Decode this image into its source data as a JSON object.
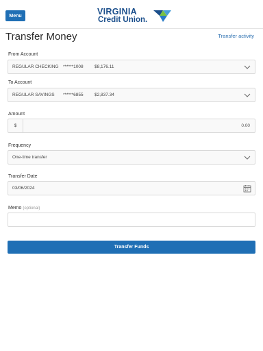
{
  "header": {
    "menu_label": "Menu",
    "logo_line1": "VIRGINIA",
    "logo_line2": "Credit Union."
  },
  "page": {
    "title": "Transfer Money",
    "activity_link": "Transfer activity"
  },
  "from_account": {
    "label": "From Account",
    "name": "REGULAR CHECKING",
    "number": "******1008",
    "balance": "$8,176.11"
  },
  "to_account": {
    "label": "To Account",
    "name": "REGULAR SAVINGS",
    "number": "******6855",
    "balance": "$2,837.34"
  },
  "amount": {
    "label": "Amount",
    "currency": "$",
    "value": "0.00"
  },
  "frequency": {
    "label": "Frequency",
    "selected": "One-time transfer"
  },
  "transfer_date": {
    "label": "Transfer Date",
    "value": "03/06/2024"
  },
  "memo": {
    "label": "Memo",
    "optional": "(optional)",
    "value": ""
  },
  "submit_label": "Transfer Funds",
  "colors": {
    "primary": "#1f6fb5",
    "brand_navy": "#1b4f8c",
    "brand_green": "#7ac143",
    "link": "#2a6fb0"
  },
  "icons": {
    "dropdown": "chevron-down-icon",
    "date": "calendar-icon"
  }
}
